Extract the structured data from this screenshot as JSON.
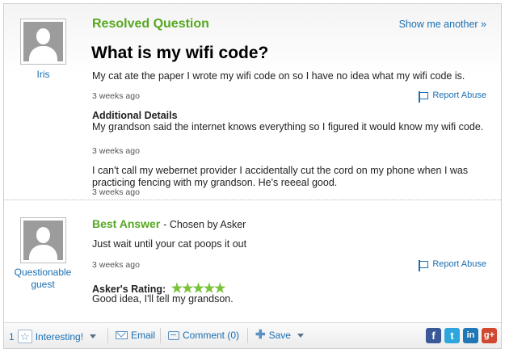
{
  "question": {
    "status": "Resolved Question",
    "show_another": "Show me another »",
    "asker": "Iris",
    "title": "What is my wifi code?",
    "body": "My cat ate the paper I wrote my wifi code on so I have no idea what my wifi code is.",
    "timestamp": "3 weeks ago",
    "report_abuse": "Report Abuse",
    "additional_details_heading": "Additional Details",
    "details": [
      {
        "text": "My grandson said the internet knows everything so I figured it would know my wifi code.",
        "timestamp": "3 weeks ago"
      },
      {
        "text": "I can't call my webernet provider I accidentally cut the cord on my phone when I was practicing fencing with my grandson. He's reeeal good.",
        "timestamp": "3 weeks ago"
      }
    ]
  },
  "answer": {
    "heading": "Best Answer",
    "chosen_by": "- Chosen by Asker",
    "answerer": "Questionable guest",
    "text": "Just wait until your cat poops it out",
    "timestamp": "3 weeks ago",
    "report_abuse": "Report Abuse",
    "rating_label": "Asker's Rating:",
    "rating_stars": "★★★★★",
    "rating_value": 5,
    "rating_comment": "Good idea, I'll tell my grandson."
  },
  "toolbar": {
    "interesting_count": "1",
    "interesting_label": "Interesting!",
    "email_label": "Email",
    "comment_label": "Comment (0)",
    "save_label": "Save",
    "social": {
      "facebook": "f",
      "twitter": "t",
      "linkedin": "in",
      "googleplus": "g+"
    }
  },
  "colors": {
    "accent_green": "#55a81f",
    "link_blue": "#1a6fb3",
    "star_green": "#79c23a"
  }
}
